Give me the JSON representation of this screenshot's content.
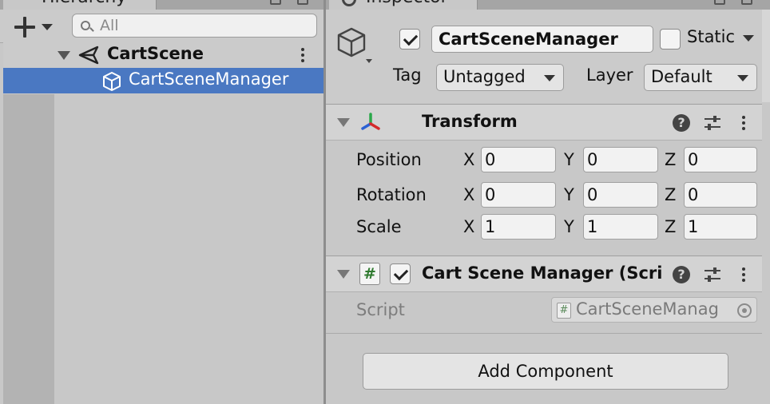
{
  "hierarchy": {
    "tab_label": "Hierarchy",
    "search_placeholder": "All",
    "scene_name": "CartScene",
    "selected_object": "CartSceneManager"
  },
  "inspector": {
    "tab_label": "Inspector",
    "object_name": "CartSceneManager",
    "active": true,
    "static_label": "Static",
    "static_checked": false,
    "tag_label": "Tag",
    "tag_value": "Untagged",
    "layer_label": "Layer",
    "layer_value": "Default",
    "transform": {
      "title": "Transform",
      "position_label": "Position",
      "rotation_label": "Rotation",
      "scale_label": "Scale",
      "axis_x": "X",
      "axis_y": "Y",
      "axis_z": "Z",
      "position": [
        "0",
        "0",
        "0"
      ],
      "rotation": [
        "0",
        "0",
        "0"
      ],
      "scale": [
        "1",
        "1",
        "1"
      ]
    },
    "script_component": {
      "title": "Cart Scene Manager (Scri",
      "enabled": true,
      "icon_glyph": "#",
      "script_label": "Script",
      "script_value": "CartSceneManag"
    },
    "add_component_label": "Add Component",
    "help_glyph": "?"
  },
  "colors": {
    "selection": "#4a78c2",
    "panel": "#c8c8c8",
    "script_green": "#2f7a2f"
  },
  "icons": {
    "hierarchy_add": "plus-icon",
    "search": "search-icon",
    "scene": "unity-logo-icon",
    "game_object": "cube-icon",
    "transform": "transform-axes-icon",
    "help": "help-icon",
    "presets": "presets-icon",
    "menu": "kebab-icon",
    "object_picker": "object-picker-icon"
  }
}
